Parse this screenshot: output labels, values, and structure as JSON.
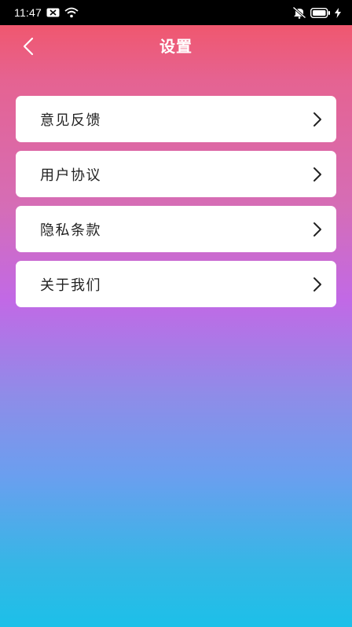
{
  "status_bar": {
    "time": "11:47",
    "icons": [
      "notification-icon",
      "wifi-icon",
      "mute-icon",
      "battery-icon",
      "charging-icon"
    ]
  },
  "header": {
    "title": "设置",
    "back_icon": "chevron-left-icon"
  },
  "menu": {
    "items": [
      {
        "label": "意见反馈",
        "icon": "chevron-right-icon"
      },
      {
        "label": "用户协议",
        "icon": "chevron-right-icon"
      },
      {
        "label": "隐私条款",
        "icon": "chevron-right-icon"
      },
      {
        "label": "关于我们",
        "icon": "chevron-right-icon"
      }
    ]
  },
  "colors": {
    "gradient_top": "#f5525f",
    "gradient_mid": "#c169e6",
    "gradient_bottom": "#1cc0e8",
    "card": "#ffffff",
    "text": "#222222"
  }
}
